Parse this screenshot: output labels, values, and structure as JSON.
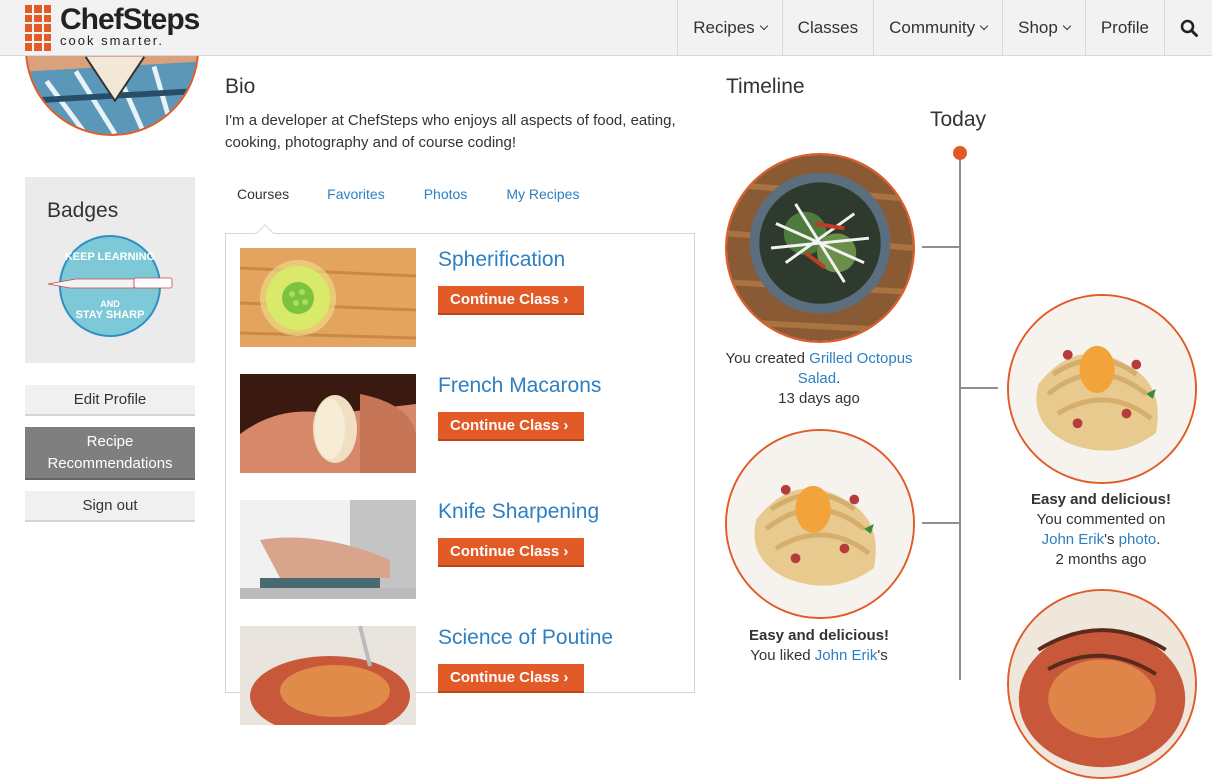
{
  "nav": {
    "logo_name": "ChefSteps",
    "logo_tag": "cook smarter.",
    "items": [
      {
        "label": "Recipes",
        "dropdown": true
      },
      {
        "label": "Classes",
        "dropdown": false
      },
      {
        "label": "Community",
        "dropdown": true
      },
      {
        "label": "Shop",
        "dropdown": true
      },
      {
        "label": "Profile",
        "dropdown": false
      }
    ],
    "search_icon": "search-icon"
  },
  "sidebar": {
    "badges_title": "Badges",
    "badge": {
      "top": "KEEP LEARNING",
      "middle": "AND",
      "bottom": "STAY SHARP"
    },
    "edit_profile": "Edit Profile",
    "recommendations": "Recipe Recommendations",
    "sign_out": "Sign out"
  },
  "bio": {
    "title": "Bio",
    "text": "I'm a developer at ChefSteps who enjoys all aspects of food, eating, cooking, photography and of course coding!"
  },
  "tabs": [
    "Courses",
    "Favorites",
    "Photos",
    "My Recipes"
  ],
  "courses": [
    {
      "title": "Spherification",
      "button": "Continue Class"
    },
    {
      "title": "French Macarons",
      "button": "Continue Class"
    },
    {
      "title": "Knife Sharpening",
      "button": "Continue Class"
    },
    {
      "title": "Science of Poutine",
      "button": "Continue Class"
    }
  ],
  "timeline": {
    "title": "Timeline",
    "today": "Today",
    "entries": [
      {
        "prefix": "You created ",
        "link": "Grilled Octopus Salad",
        "suffix": ".",
        "time": "13 days ago"
      },
      {
        "heading": "Easy and delicious!",
        "prefix": "You commented on ",
        "link": "John Erik",
        "middle": "'s ",
        "link2": "photo",
        "suffix": ".",
        "time": "2 months ago"
      },
      {
        "heading": "Easy and delicious!",
        "prefix": "You liked ",
        "link": "John Erik",
        "middle": "'s"
      }
    ]
  },
  "colors": {
    "accent": "#e25a26",
    "link": "#2d7fc1",
    "nav_bg": "#f2f2f2"
  }
}
